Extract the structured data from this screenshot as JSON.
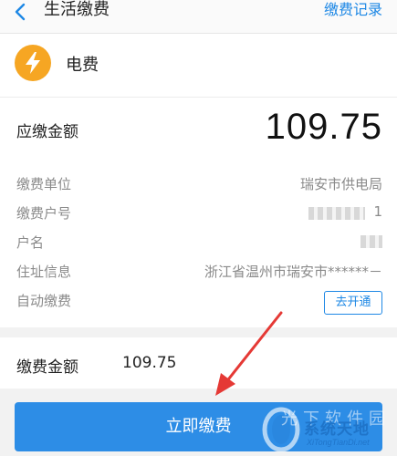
{
  "header": {
    "back_icon": "chevron-left-icon",
    "title": "生活缴费",
    "history_link": "缴费记录"
  },
  "biller": {
    "icon": "lightning-bolt-icon",
    "icon_color": "#f6a623",
    "name": "电费"
  },
  "due": {
    "label": "应缴金额",
    "amount": "109.75"
  },
  "details": [
    {
      "label": "缴费单位",
      "value": "瑞安市供电局"
    },
    {
      "label": "缴费户号",
      "value": "1",
      "masked": true
    },
    {
      "label": "户名",
      "value": "",
      "masked": true
    },
    {
      "label": "住址信息",
      "value": "浙江省温州市瑞安市******－"
    },
    {
      "label": "自动缴费",
      "button": "去开通"
    }
  ],
  "payment": {
    "label": "缴费金额",
    "value": "109.75"
  },
  "pay_button": {
    "label": "立即缴费",
    "color": "#2d8de6"
  },
  "watermark": {
    "text": "系统天地",
    "sub": "XiTongTianDi.net",
    "ghost": "光下软件园"
  },
  "accent_color": "#1e88e5"
}
